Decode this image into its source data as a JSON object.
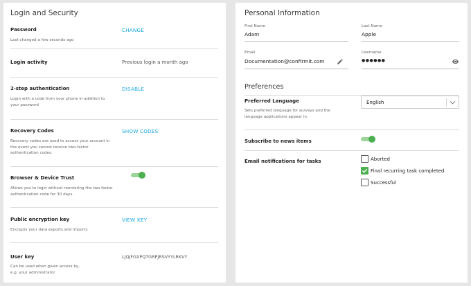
{
  "login_security": {
    "title": "Login and Security",
    "rows": [
      {
        "label": "Password",
        "desc": "Last changed a few seconds ago",
        "action": "CHANGE"
      },
      {
        "label": "Login activity",
        "info": "Previous login a month ago"
      },
      {
        "label": "2-step authentication",
        "desc": "Login with a code from your phone in addition to your password",
        "action": "DISABLE"
      },
      {
        "label": "Recovery Codes",
        "desc": "Recovery codes are used to access your account in the event you cannot receive two-factor authentication codes.",
        "action": "SHOW CODES"
      },
      {
        "label": "Browser & Device Trust",
        "desc": "Allows you to login without reentering the two factor authentication code for 30 days.",
        "toggle_on": true
      },
      {
        "label": "Public encryption key",
        "desc": "Encrypts your data exports and imports",
        "action": "VIEW KEY"
      },
      {
        "label": "User key",
        "desc": "Can be used when given access by, e.g. your administrator",
        "info": "LJQJFGXPQTGRPJRSVYYLRKVY"
      }
    ]
  },
  "personal": {
    "title": "Personal Information",
    "first_name_label": "First Name",
    "first_name": "Adam",
    "last_name_label": "Last Name",
    "last_name": "Apple",
    "email_label": "Email",
    "email": "Documentation@confirmit.com",
    "username_label": "Username",
    "username_masked": "●●●●●●",
    "edit_icon": "pencil-icon",
    "show_icon": "eye-icon"
  },
  "preferences": {
    "title": "Preferences",
    "language_label": "Preferred Language",
    "language_desc": "Sets preferred language for surveys and the language applications appear in.",
    "language_value": "English",
    "news_label": "Subscribe to news items",
    "news_on": true,
    "notifications_label": "Email notifications for tasks",
    "notification_options": [
      {
        "label": "Aborted",
        "checked": false
      },
      {
        "label": "Final recurring task completed",
        "checked": true
      },
      {
        "label": "Successful",
        "checked": false
      }
    ]
  },
  "colors": {
    "accent": "#1ba7e0",
    "toggle_on": "#4caf50",
    "checkbox_checked": "#4caf50",
    "background": "#e6e6e6"
  }
}
